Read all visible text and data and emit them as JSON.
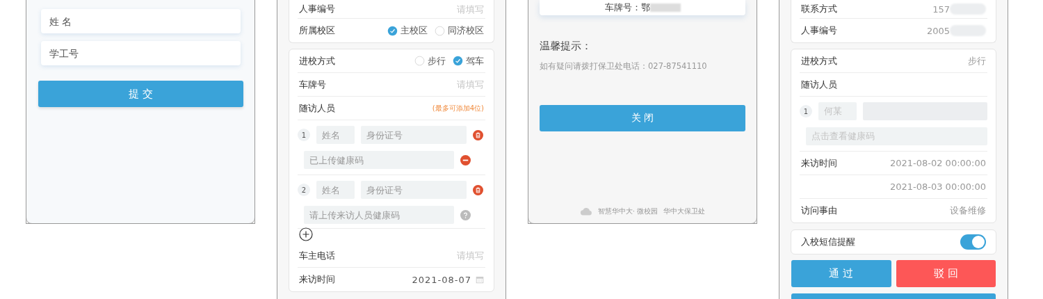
{
  "login_screen": {
    "fields": [
      {
        "placeholder": "姓 名"
      },
      {
        "placeholder": "学工号"
      }
    ],
    "submit_button": "提 交"
  },
  "application_form": {
    "personal_card": {
      "rows": [
        {
          "kind": "input",
          "label": "人事编号",
          "placeholder": "请填写"
        },
        {
          "kind": "radio",
          "label": "所属校区",
          "options": [
            {
              "label": "主校区",
              "selected": true
            },
            {
              "label": "同济校区",
              "selected": false
            }
          ]
        }
      ]
    },
    "visit_card": {
      "rows": [
        {
          "kind": "radio",
          "label": "进校方式",
          "options": [
            {
              "label": "步行",
              "selected": false
            },
            {
              "label": "驾车",
              "selected": true
            }
          ]
        },
        {
          "kind": "input",
          "label": "车牌号",
          "placeholder": "请填写"
        },
        {
          "kind": "companions",
          "label": "随访人员",
          "note": "(最多可添加4位)",
          "can_add": true,
          "companions": [
            {
              "number": "1",
              "name_placeholder": "姓名",
              "id_placeholder": "身份证号",
              "health_code_placeholder": "已上传健康码",
              "uploaded": true
            },
            {
              "number": "2",
              "name_placeholder": "姓名",
              "id_placeholder": "身份证号",
              "health_code_placeholder": "请上传来访人员健康码",
              "uploaded": false
            }
          ]
        },
        {
          "kind": "input",
          "label": "车主电话",
          "placeholder": "请填写"
        },
        {
          "kind": "date",
          "label": "来访时间",
          "value": "2021-08-07"
        }
      ]
    }
  },
  "result_screen": {
    "plate_text": "车牌号：鄂",
    "plate_redacted": true,
    "tips_title": "温馨提示：",
    "tips_text": "如有疑问请拨打保卫处电话：027-87541110",
    "close_button": "关 闭",
    "footer": [
      "智慧华中大· 微校园",
      "华中大保卫处"
    ]
  },
  "review_screen": {
    "personal_card": {
      "rows": [
        {
          "kind": "value",
          "label": "联系方式",
          "value": "157",
          "redacted": true
        },
        {
          "kind": "value",
          "label": "人事编号",
          "value": "2005",
          "redacted": true
        }
      ]
    },
    "visit_card": {
      "rows": [
        {
          "kind": "value",
          "label": "进校方式",
          "value": "步行",
          "redacted": false
        },
        {
          "kind": "companions",
          "label": "随访人员",
          "companions": [
            {
              "number": "1",
              "name": "何某",
              "id_redacted": true,
              "health_code_link": "点击查看健康码"
            }
          ]
        },
        {
          "kind": "value",
          "label": "来访时间",
          "value": "2021-08-02 00:00:00",
          "redacted": false
        },
        {
          "kind": "value",
          "value": "2021-08-03 00:00:00",
          "redacted": false
        },
        {
          "kind": "value",
          "label": "访问事由",
          "value": "设备维修",
          "redacted": false
        }
      ]
    },
    "sms_card": {
      "label": "入校短信提醒",
      "on": true
    },
    "buttons": [
      {
        "kind": "approve",
        "label": "通 过"
      },
      {
        "kind": "reject",
        "label": "驳 回"
      }
    ]
  }
}
